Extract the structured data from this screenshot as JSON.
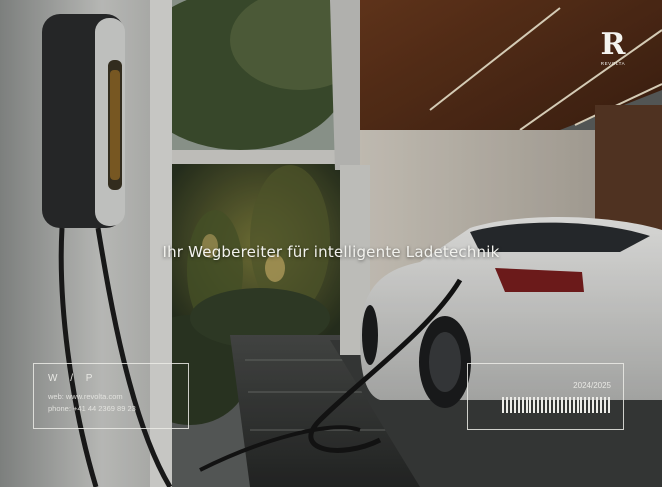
{
  "headline": "Ihr Wegbereiter für intelligente Ladetechnik",
  "brand": {
    "mark": "R",
    "name": "REVOLTA"
  },
  "contact": {
    "title": "W / P",
    "web": "web: www.revolta.com",
    "phone": "phone: +41 44 2369 89 23"
  },
  "year_label": "2024/2025",
  "barcode_bars": 28,
  "colors": {
    "text": "#f2f2ee",
    "frame": "#ebebe6"
  }
}
